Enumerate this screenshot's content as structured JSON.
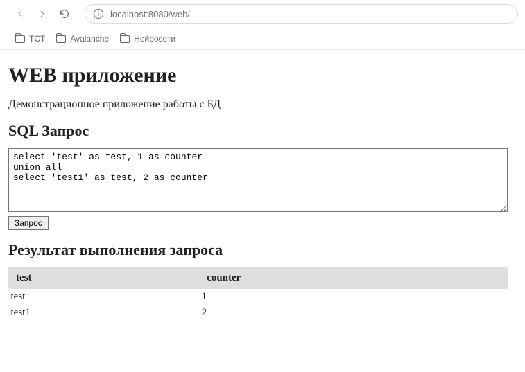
{
  "browser": {
    "url": "localhost:8080",
    "path": "/web/",
    "bookmarks": [
      {
        "label": "TCT"
      },
      {
        "label": "Avalanche"
      },
      {
        "label": "Нейросети"
      }
    ]
  },
  "page": {
    "heading": "WEB приложение",
    "subtitle": "Демонстрационное приложение работы с БД",
    "sql_heading": "SQL Запрос",
    "sql_query": "select 'test' as test, 1 as counter\nunion all\nselect 'test1' as test, 2 as counter",
    "submit_label": "Запрос",
    "result_heading": "Результат выполнения запроса",
    "result_table": {
      "headers": [
        "test",
        "counter"
      ],
      "rows": [
        [
          "test",
          "1"
        ],
        [
          "test1",
          "2"
        ]
      ]
    }
  }
}
